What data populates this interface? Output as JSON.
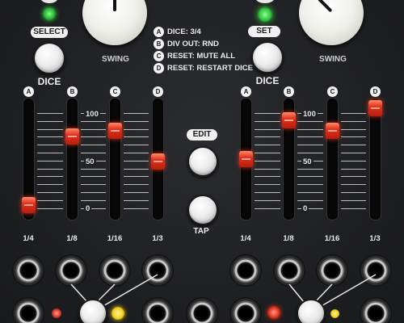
{
  "labels": {
    "select_button": "SELECT",
    "set_button": "SET",
    "swing_left": "SWING",
    "swing_right": "SWING",
    "dice_left": "DICE",
    "dice_right": "DICE",
    "edit_button": "EDIT",
    "tap_label": "TAP"
  },
  "info_list": [
    {
      "badge": "A",
      "text": "DICE: 3/4"
    },
    {
      "badge": "B",
      "text": "DIV OUT: RND"
    },
    {
      "badge": "C",
      "text": "RESET: MUTE ALL"
    },
    {
      "badge": "D",
      "text": "RESET: RESTART DICE"
    }
  ],
  "scale_labels": [
    "100",
    "50",
    "0"
  ],
  "left_channels": [
    {
      "badge": "A",
      "division": "1/4",
      "level": 0.05
    },
    {
      "badge": "B",
      "division": "1/8",
      "level": 0.72
    },
    {
      "badge": "C",
      "division": "1/16",
      "level": 0.78
    },
    {
      "badge": "D",
      "division": "1/3",
      "level": 0.48
    }
  ],
  "right_channels": [
    {
      "badge": "A",
      "division": "1/4",
      "level": 0.5
    },
    {
      "badge": "B",
      "division": "1/8",
      "level": 0.88
    },
    {
      "badge": "C",
      "division": "1/16",
      "level": 0.78
    },
    {
      "badge": "D",
      "division": "1/3",
      "level": 1.0
    }
  ],
  "colors": {
    "led_red": "#d83a2c",
    "led_green": "#3bd63c",
    "led_yellow": "#f4d21c",
    "fader_cap": "#e0321c"
  }
}
